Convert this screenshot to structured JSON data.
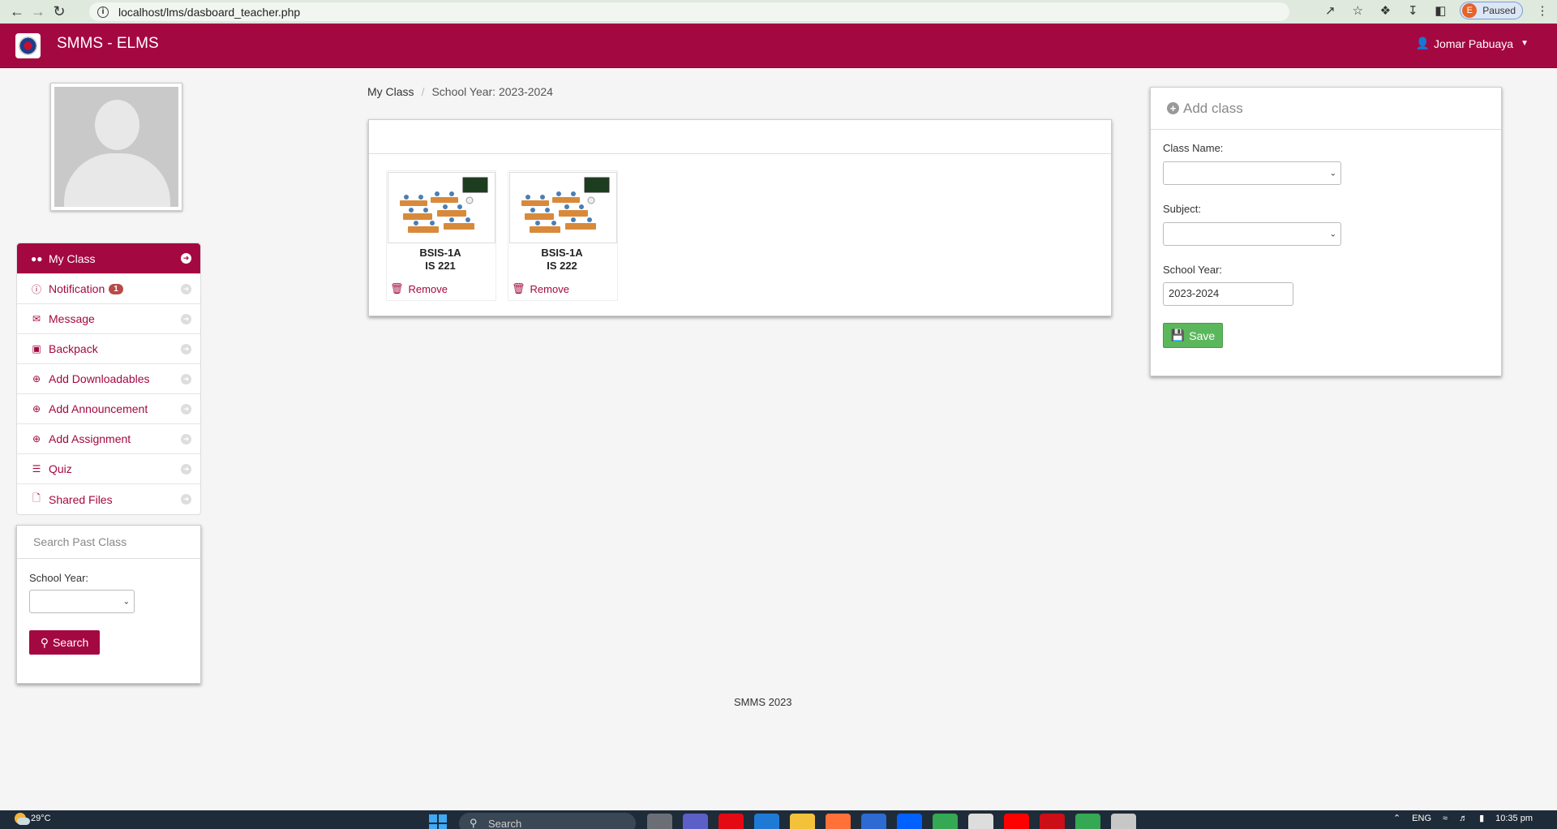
{
  "browser": {
    "url": "localhost/lms/dasboard_teacher.php",
    "profile_initial": "E",
    "profile_status": "Paused"
  },
  "header": {
    "title": "SMMS - ELMS",
    "user": "Jomar Pabuaya"
  },
  "sidebar": {
    "items": [
      {
        "label": "My Class",
        "icon": "users-icon"
      },
      {
        "label": "Notification",
        "icon": "info-icon",
        "badge": "1"
      },
      {
        "label": "Message",
        "icon": "envelope-icon"
      },
      {
        "label": "Backpack",
        "icon": "briefcase-icon"
      },
      {
        "label": "Add Downloadables",
        "icon": "plus-circle-icon"
      },
      {
        "label": "Add Announcement",
        "icon": "plus-circle-icon"
      },
      {
        "label": "Add Assignment",
        "icon": "plus-circle-icon"
      },
      {
        "label": "Quiz",
        "icon": "list-icon"
      },
      {
        "label": "Shared Files",
        "icon": "file-icon"
      }
    ],
    "search_panel": {
      "title": "Search Past Class",
      "school_year_label": "School Year:",
      "school_year_value": "",
      "search_button": "Search"
    }
  },
  "breadcrumb": {
    "home": "My Class",
    "current": "School Year: 2023-2024"
  },
  "classes": [
    {
      "section": "BSIS-1A",
      "subject": "IS 221",
      "remove": "Remove"
    },
    {
      "section": "BSIS-1A",
      "subject": "IS 222",
      "remove": "Remove"
    }
  ],
  "add_class": {
    "title": "Add class",
    "class_name_label": "Class Name:",
    "class_name_value": "",
    "subject_label": "Subject:",
    "subject_value": "",
    "school_year_label": "School Year:",
    "school_year_value": "2023-2024",
    "save_button": "Save"
  },
  "footer": "SMMS 2023",
  "taskbar": {
    "temperature": "29°C",
    "search_placeholder": "Search",
    "language": "ENG",
    "time": "10:35 pm"
  },
  "colors": {
    "brand": "#a40841",
    "save": "#5bb75b",
    "badge": "#b94a48"
  }
}
